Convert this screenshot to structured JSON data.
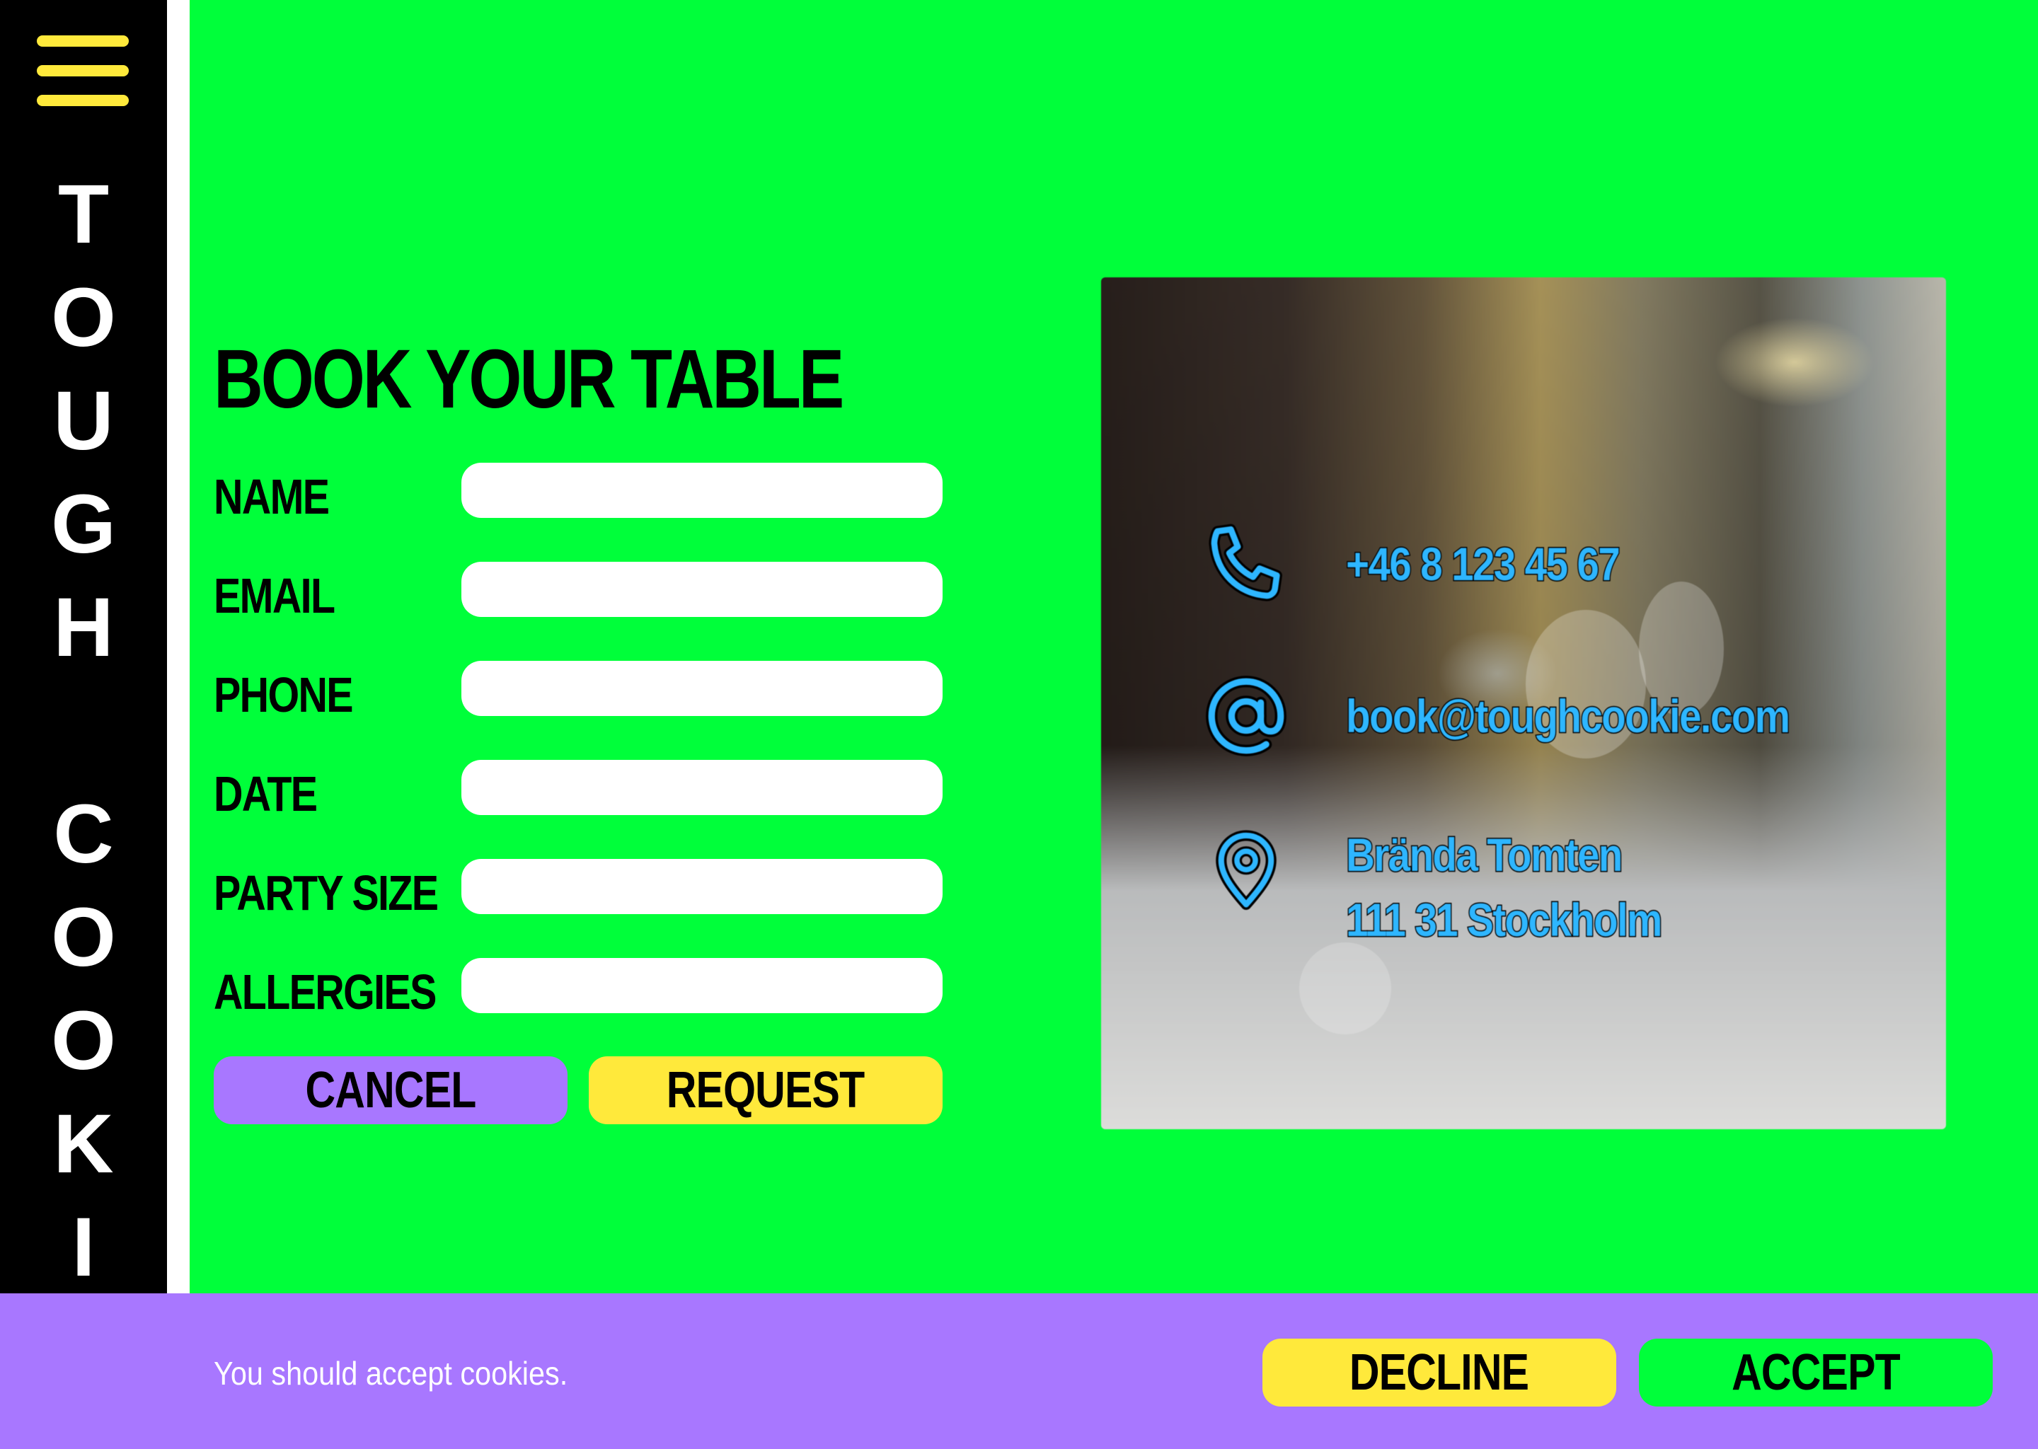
{
  "sidebar": {
    "brand_letters": [
      "T",
      "O",
      "U",
      "G",
      "H",
      "",
      "C",
      "O",
      "O",
      "K",
      "I"
    ]
  },
  "form": {
    "title": "BOOK YOUR TABLE",
    "fields": [
      {
        "label": "NAME",
        "value": ""
      },
      {
        "label": "EMAIL",
        "value": ""
      },
      {
        "label": "PHONE",
        "value": ""
      },
      {
        "label": "DATE",
        "value": ""
      },
      {
        "label": "PARTY SIZE",
        "value": ""
      },
      {
        "label": "ALLERGIES",
        "value": ""
      }
    ],
    "cancel_label": "CANCEL",
    "request_label": "REQUEST"
  },
  "contact": {
    "phone": "+46 8 123 45 67",
    "email": "book@toughcookie.com",
    "address_line1": "Brända Tomten",
    "address_line2": "111 31 Stockholm",
    "icons": [
      "phone-icon",
      "at-sign-icon",
      "map-pin-icon"
    ]
  },
  "cookie_bar": {
    "message": "You should accept cookies.",
    "decline_label": "DECLINE",
    "accept_label": "ACCEPT"
  },
  "colors": {
    "background": "#00ff3a",
    "sidebar": "#000000",
    "accent_yellow": "#ffe93b",
    "accent_purple": "#a877ff",
    "contact_text": "#2eb6ff"
  }
}
